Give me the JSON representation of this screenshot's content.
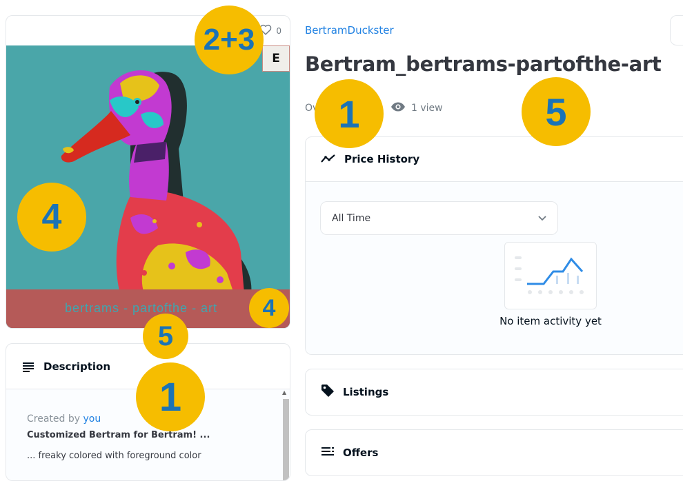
{
  "item": {
    "like_count": "0",
    "edition_badge": "E",
    "image_caption": "bertrams - partofthe - art",
    "collection": "BertramDuckster",
    "title": "Bertram_bertrams-partofthe-art",
    "owner_partial": "Ov",
    "views": "1 view"
  },
  "description": {
    "title": "Description",
    "created_by_label": "Created by",
    "created_by_user": "you",
    "headline": "Customized Bertram for Bertram! ...",
    "line2": "... freaky colored with foreground color"
  },
  "price_history": {
    "title": "Price History",
    "filter_value": "All Time",
    "empty_text": "No item activity yet"
  },
  "sections": {
    "listings": "Listings",
    "offers": "Offers"
  },
  "annotations": {
    "m1": "2+3",
    "m2": "1",
    "m3": "5",
    "m4": "4",
    "m5": "4",
    "m6": "5",
    "m7": "1"
  },
  "colors": {
    "accent": "#2081e2",
    "marker": "#f6bd00",
    "marker_text": "#1b73b6",
    "art_background": "#4aa6a9",
    "caption_band": "#b55a58"
  },
  "icons": [
    "heart-icon",
    "eye-icon",
    "chart-line-icon",
    "chevron-down-icon",
    "description-icon",
    "tag-icon",
    "offers-list-icon"
  ]
}
